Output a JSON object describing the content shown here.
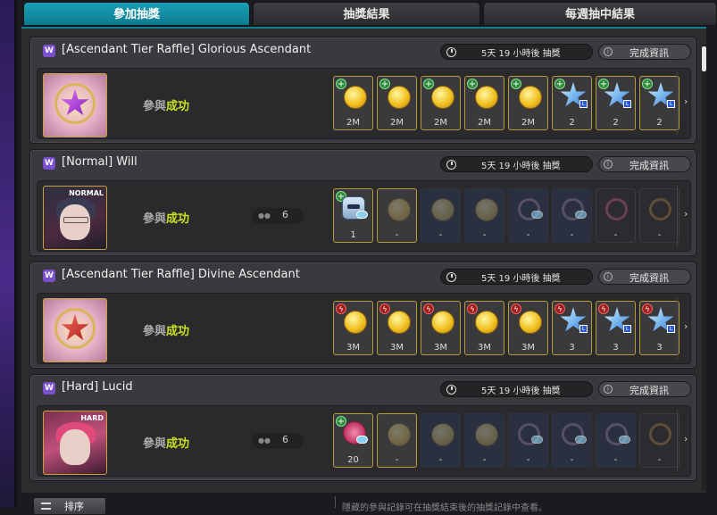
{
  "tabs": [
    {
      "label": "參加抽獎",
      "active": true
    },
    {
      "label": "抽獎結果",
      "active": false
    },
    {
      "label": "每週抽中結果",
      "active": false
    }
  ],
  "badge_letter": "W",
  "timer_icon": "clock-icon",
  "info_label": "完成資訊",
  "participate_prefix": "參與",
  "participate_status": "成功",
  "raffles": [
    {
      "title": "[Ascendant Tier Raffle] Glorious Ascendant",
      "timer": "5天 19 小時後 抽獎",
      "boss_tag": "",
      "members": "",
      "rewards": [
        {
          "icon": "gold-coin-icon",
          "badge": "plus",
          "caption": "2M"
        },
        {
          "icon": "gold-coin-icon",
          "badge": "plus",
          "caption": "2M"
        },
        {
          "icon": "gold-coin-icon",
          "badge": "plus",
          "caption": "2M"
        },
        {
          "icon": "gold-coin-icon",
          "badge": "plus",
          "caption": "2M"
        },
        {
          "icon": "gold-coin-icon",
          "badge": "plus",
          "caption": "2M"
        },
        {
          "icon": "blue-star-icon",
          "badge": "plus",
          "caption": "2"
        },
        {
          "icon": "blue-star-icon",
          "badge": "plus",
          "caption": "2"
        },
        {
          "icon": "blue-star-icon",
          "badge": "plus",
          "caption": "2"
        }
      ]
    },
    {
      "title": "[Normal] Will",
      "timer": "5天 19 小時後 抽獎",
      "boss_tag": "NORMAL",
      "members": "6",
      "rewards": [
        {
          "icon": "robot-icon",
          "badge": "plus",
          "caption": "1"
        },
        {
          "icon": "gold-coin-icon",
          "badge": "",
          "caption": "-"
        },
        {
          "icon": "gold-coin-icon",
          "badge": "",
          "caption": "-"
        },
        {
          "icon": "gold-coin-icon",
          "badge": "",
          "caption": "-"
        },
        {
          "icon": "ring-icon",
          "badge": "",
          "caption": "-"
        },
        {
          "icon": "ring-icon",
          "badge": "",
          "caption": "-"
        },
        {
          "icon": "pink-ring-icon",
          "badge": "",
          "caption": "-"
        },
        {
          "icon": "bronze-ring-icon",
          "badge": "",
          "caption": "-"
        }
      ]
    },
    {
      "title": "[Ascendant Tier Raffle] Divine Ascendant",
      "timer": "5天 19 小時後 抽獎",
      "boss_tag": "",
      "members": "",
      "rewards": [
        {
          "icon": "gold-coin-icon",
          "badge": "bolt",
          "caption": "3M"
        },
        {
          "icon": "gold-coin-icon",
          "badge": "bolt",
          "caption": "3M"
        },
        {
          "icon": "gold-coin-icon",
          "badge": "bolt",
          "caption": "3M"
        },
        {
          "icon": "gold-coin-icon",
          "badge": "bolt",
          "caption": "3M"
        },
        {
          "icon": "gold-coin-icon",
          "badge": "bolt",
          "caption": "3M"
        },
        {
          "icon": "blue-star-icon",
          "badge": "bolt",
          "caption": "3"
        },
        {
          "icon": "blue-star-icon",
          "badge": "bolt",
          "caption": "3"
        },
        {
          "icon": "blue-star-icon",
          "badge": "bolt",
          "caption": "3"
        }
      ]
    },
    {
      "title": "[Hard] Lucid",
      "timer": "5天 19 小時後 抽獎",
      "boss_tag": "HARD",
      "members": "6",
      "rewards": [
        {
          "icon": "heart-icon",
          "badge": "plus",
          "caption": "20"
        },
        {
          "icon": "gold-coin-icon",
          "badge": "",
          "caption": "-"
        },
        {
          "icon": "gold-coin-icon",
          "badge": "",
          "caption": "-"
        },
        {
          "icon": "gold-coin-icon",
          "badge": "",
          "caption": "-"
        },
        {
          "icon": "ring-icon",
          "badge": "",
          "caption": "-"
        },
        {
          "icon": "ring-icon",
          "badge": "",
          "caption": "-"
        },
        {
          "icon": "ring-icon",
          "badge": "",
          "caption": "-"
        },
        {
          "icon": "bronze-ring-icon",
          "badge": "",
          "caption": "-"
        }
      ]
    }
  ],
  "sort_label": "排序",
  "footnote": "隱藏的參與記錄可在抽獎結束後的抽獎記錄中查看。"
}
